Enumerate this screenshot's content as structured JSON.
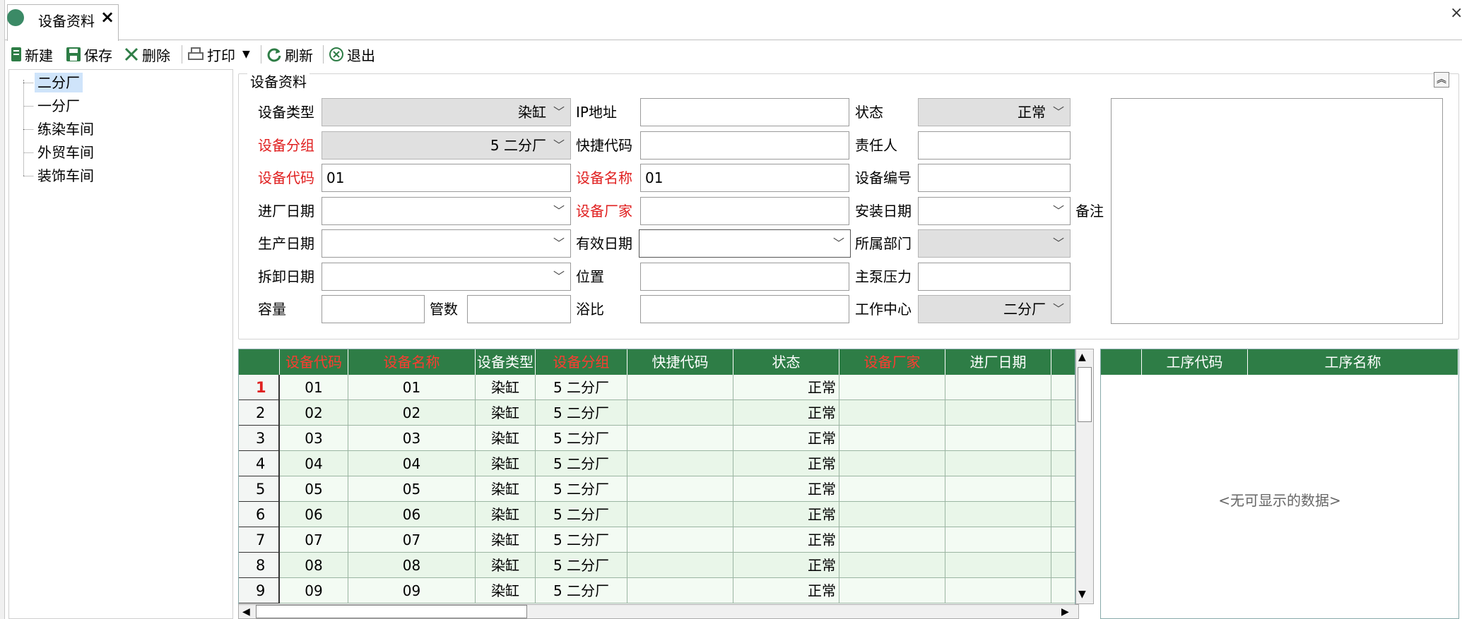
{
  "tab": {
    "title": "设备资料",
    "close": "×"
  },
  "window": {
    "close": "×"
  },
  "toolbar": {
    "new": "新建",
    "save": "保存",
    "delete": "删除",
    "print": "打印",
    "refresh": "刷新",
    "exit": "退出"
  },
  "tree": {
    "items": [
      "二分厂",
      "一分厂",
      "练染车间",
      "外贸车间",
      "装饰车间"
    ],
    "selected": "二分厂"
  },
  "form": {
    "group_title": "设备资料",
    "labels": {
      "type": "设备类型",
      "ip": "IP地址",
      "status": "状态",
      "group": "设备分组",
      "quick_code": "快捷代码",
      "owner": "责任人",
      "code": "设备代码",
      "name": "设备名称",
      "serial": "设备编号",
      "entry_date": "进厂日期",
      "maker": "设备厂家",
      "install_date": "安装日期",
      "remark": "备注",
      "prod_date": "生产日期",
      "valid_date": "有效日期",
      "dept": "所属部门",
      "remove_date": "拆卸日期",
      "position": "位置",
      "pump_pressure": "主泵压力",
      "capacity": "容量",
      "tubes": "管数",
      "bath_ratio": "浴比",
      "work_center": "工作中心"
    },
    "values": {
      "type": "染缸",
      "status": "正常",
      "group": "5 二分厂",
      "code": "01",
      "name": "01",
      "work_center": "二分厂"
    }
  },
  "grid": {
    "columns": [
      "设备代码",
      "设备名称",
      "设备类型",
      "设备分组",
      "快捷代码",
      "状态",
      "设备厂家",
      "进厂日期"
    ],
    "rows": [
      {
        "n": "1",
        "code": "01",
        "name": "01",
        "type": "染缸",
        "group": "5 二分厂",
        "status": "正常"
      },
      {
        "n": "2",
        "code": "02",
        "name": "02",
        "type": "染缸",
        "group": "5 二分厂",
        "status": "正常"
      },
      {
        "n": "3",
        "code": "03",
        "name": "03",
        "type": "染缸",
        "group": "5 二分厂",
        "status": "正常"
      },
      {
        "n": "4",
        "code": "04",
        "name": "04",
        "type": "染缸",
        "group": "5 二分厂",
        "status": "正常"
      },
      {
        "n": "5",
        "code": "05",
        "name": "05",
        "type": "染缸",
        "group": "5 二分厂",
        "status": "正常"
      },
      {
        "n": "6",
        "code": "06",
        "name": "06",
        "type": "染缸",
        "group": "5 二分厂",
        "status": "正常"
      },
      {
        "n": "7",
        "code": "07",
        "name": "07",
        "type": "染缸",
        "group": "5 二分厂",
        "status": "正常"
      },
      {
        "n": "8",
        "code": "08",
        "name": "08",
        "type": "染缸",
        "group": "5 二分厂",
        "status": "正常"
      },
      {
        "n": "9",
        "code": "09",
        "name": "09",
        "type": "染缸",
        "group": "5 二分厂",
        "status": "正常"
      }
    ]
  },
  "process_grid": {
    "columns": [
      "工序代码",
      "工序名称"
    ],
    "empty": "<无可显示的数据>"
  },
  "colors": {
    "header_green": "#2e7d46",
    "row_even": "#f3fbf3",
    "row_odd": "#e9f6e9",
    "required_red": "#e02020"
  }
}
